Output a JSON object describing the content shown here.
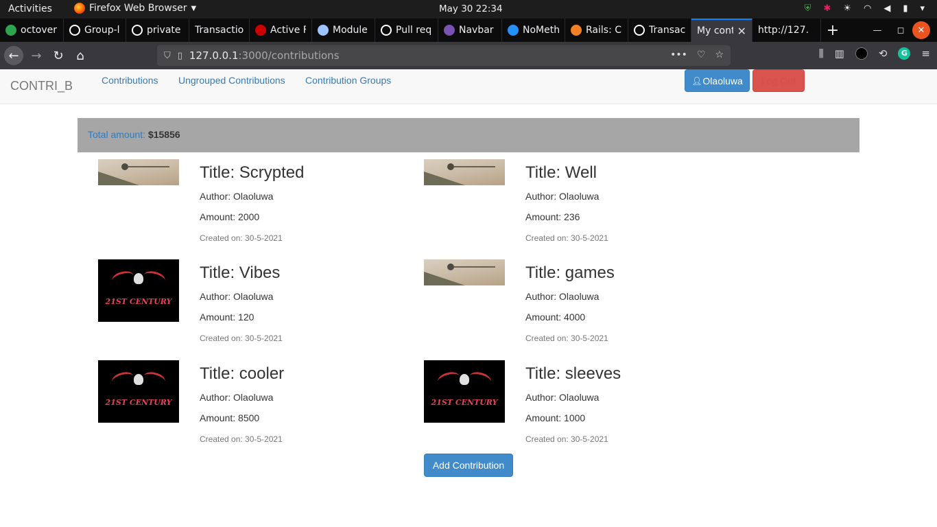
{
  "desktop": {
    "activities": "Activities",
    "app_name": "Firefox Web Browser",
    "clock": "May 30  22:34"
  },
  "browser": {
    "tabs": [
      {
        "label": "octover",
        "icon": "green-circle-icon",
        "color": "#2ea44f"
      },
      {
        "label": "Group-l",
        "icon": "github-icon",
        "color": "#ffffff"
      },
      {
        "label": "private",
        "icon": "github-icon",
        "color": "#ffffff"
      },
      {
        "label": "Transaction",
        "icon": "",
        "color": ""
      },
      {
        "label": "Active F",
        "icon": "rails-icon",
        "color": "#cc0000"
      },
      {
        "label": "Module",
        "icon": "module-icon",
        "color": "#9ec3ff"
      },
      {
        "label": "Pull req",
        "icon": "github-icon",
        "color": "#ffffff"
      },
      {
        "label": "Navbar",
        "icon": "bootstrap-icon",
        "color": "#7952b3"
      },
      {
        "label": "NoMeth",
        "icon": "bing-icon",
        "color": "#258ffa"
      },
      {
        "label": "Rails: C",
        "icon": "stackoverflow-icon",
        "color": "#f48024"
      },
      {
        "label": "Transac",
        "icon": "github-icon",
        "color": "#ffffff"
      },
      {
        "label": "My cont",
        "icon": "",
        "color": "",
        "active": true
      },
      {
        "label": "http://127.",
        "icon": "",
        "color": ""
      }
    ],
    "url_host": "127.0.0.1",
    "url_rest": ":3000/contributions"
  },
  "site": {
    "brand": "CONTRI_B",
    "nav": [
      "Contributions",
      "Ungrouped Contributions",
      "Contribution Groups"
    ],
    "user_button": "Olaoluwa",
    "logout_button": "Log Out",
    "total_label": "Total amount:",
    "total_value": "$15856",
    "add_button": "Add Contribution"
  },
  "contributions": [
    {
      "title": "Title: Scrypted",
      "author": "Author: Olaoluwa",
      "amount": "Amount: 2000",
      "created": "Created on: 30-5-2021",
      "image": "paper"
    },
    {
      "title": "Title: Well",
      "author": "Author: Olaoluwa",
      "amount": "Amount: 236",
      "created": "Created on: 30-5-2021",
      "image": "paper"
    },
    {
      "title": "Title: Vibes",
      "author": "Author: Olaoluwa",
      "amount": "Amount: 120",
      "created": "Created on: 30-5-2021",
      "image": "logo"
    },
    {
      "title": "Title: games",
      "author": "Author: Olaoluwa",
      "amount": "Amount: 4000",
      "created": "Created on: 30-5-2021",
      "image": "paper"
    },
    {
      "title": "Title: cooler",
      "author": "Author: Olaoluwa",
      "amount": "Amount: 8500",
      "created": "Created on: 30-5-2021",
      "image": "logo"
    },
    {
      "title": "Title: sleeves",
      "author": "Author: Olaoluwa",
      "amount": "Amount: 1000",
      "created": "Created on: 30-5-2021",
      "image": "logo"
    }
  ],
  "image_text": {
    "logo": "21ST CENTURY"
  }
}
